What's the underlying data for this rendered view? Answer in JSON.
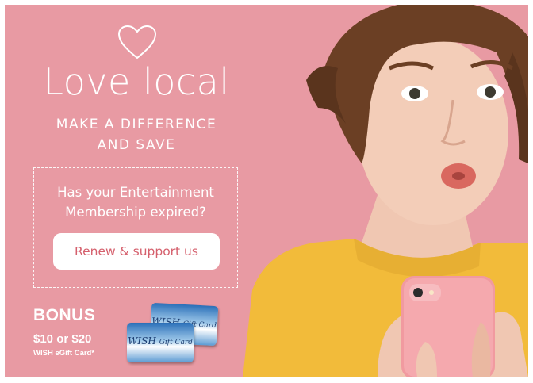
{
  "colors": {
    "background": "#e89aa3",
    "text": "#ffffff",
    "button_text": "#d5606d",
    "shirt": "#f2bb3a"
  },
  "icons": {
    "heart": "heart-outline-icon"
  },
  "hero": {
    "headline": "Love local",
    "tagline_line1": "MAKE A DIFFERENCE",
    "tagline_line2": "AND SAVE"
  },
  "promo": {
    "question_line1": "Has your Entertainment",
    "question_line2": "Membership expired?",
    "button_label": "Renew & support us"
  },
  "bonus": {
    "title": "BONUS",
    "amount": "$10 or $20",
    "card_label": "WISH eGift Card*",
    "card_brand": "WISH",
    "card_script": "Gift Card"
  }
}
